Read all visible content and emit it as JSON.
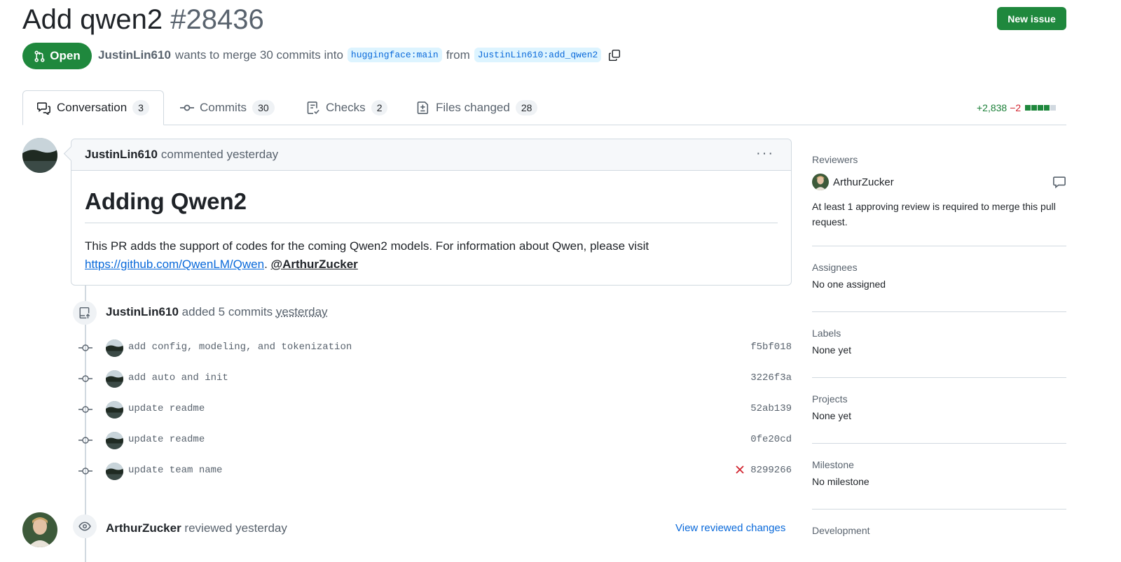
{
  "header": {
    "title": "Add qwen2",
    "number": "#28436",
    "new_issue_label": "New issue",
    "state": "Open",
    "author": "JustinLin610",
    "merge_text": "wants to merge 30 commits into",
    "base_branch": "huggingface:main",
    "from_text": "from",
    "head_branch": "JustinLin610:add_qwen2"
  },
  "tabs": [
    {
      "label": "Conversation",
      "count": "3"
    },
    {
      "label": "Commits",
      "count": "30"
    },
    {
      "label": "Checks",
      "count": "2"
    },
    {
      "label": "Files changed",
      "count": "28"
    }
  ],
  "diffstat": {
    "additions": "+2,838",
    "deletions": "−2"
  },
  "comment": {
    "author": "JustinLin610",
    "action": "commented yesterday",
    "heading": "Adding Qwen2",
    "body": "This PR adds the support of codes for the coming Qwen2 models. For information about Qwen, please visit",
    "link": "https://github.com/QwenLM/Qwen",
    "after_link": ".",
    "mention": "@ArthurZucker"
  },
  "commits_event": {
    "author": "JustinLin610",
    "action": "added 5 commits",
    "time": "yesterday"
  },
  "commits": [
    {
      "message": "add config, modeling, and tokenization",
      "sha": "f5bf018"
    },
    {
      "message": "add auto and init",
      "sha": "3226f3a"
    },
    {
      "message": "update readme",
      "sha": "52ab139"
    },
    {
      "message": "update readme",
      "sha": "0fe20cd"
    },
    {
      "message": "update team name",
      "sha": "8299266",
      "status": "failed"
    }
  ],
  "review_event": {
    "author": "ArthurZucker",
    "action": "reviewed yesterday",
    "view_label": "View reviewed changes"
  },
  "sidebar": {
    "reviewers_label": "Reviewers",
    "reviewer": "ArthurZucker",
    "reviewer_note": "At least 1 approving review is required to merge this pull request.",
    "assignees_label": "Assignees",
    "assignees_value": "No one assigned",
    "labels_label": "Labels",
    "labels_value": "None yet",
    "projects_label": "Projects",
    "projects_value": "None yet",
    "milestone_label": "Milestone",
    "milestone_value": "No milestone",
    "development_label": "Development"
  },
  "colors": {
    "green": "#1f883d",
    "link": "#0969da",
    "muted": "#59636e",
    "border": "#d1d9e0",
    "danger": "#d1242f"
  }
}
